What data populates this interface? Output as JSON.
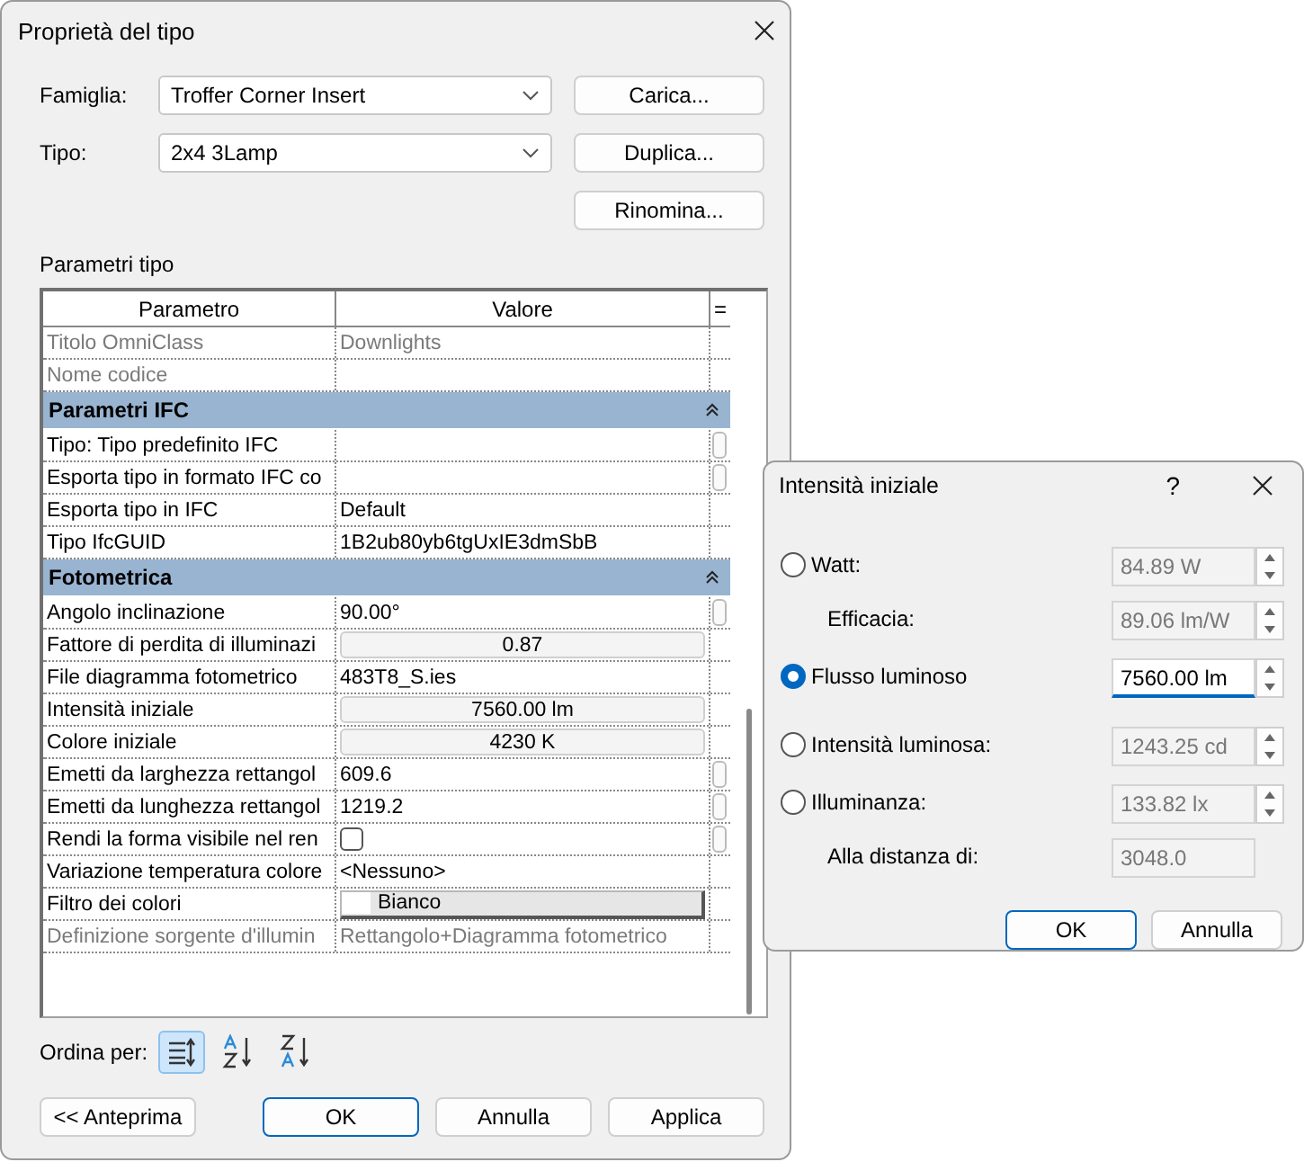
{
  "dialog": {
    "title": "Proprietà del tipo",
    "fields": [
      {
        "label": "Famiglia:",
        "value": "Troffer Corner Insert",
        "button": "Carica..."
      },
      {
        "label": "Tipo:",
        "value": "2x4 3Lamp",
        "button": "Duplica..."
      },
      {
        "button": "Rinomina..."
      }
    ],
    "section_label": "Parametri tipo",
    "table": {
      "columns": [
        "Parametro",
        "Valore",
        "="
      ],
      "rows": [
        {
          "kind": "param",
          "name": "Titolo OmniClass",
          "value": "Downlights",
          "disabled": true,
          "side_button": false
        },
        {
          "kind": "param",
          "name": "Nome codice",
          "value": "",
          "disabled": true,
          "side_button": false
        },
        {
          "kind": "group",
          "name": "Parametri IFC",
          "expanded": true
        },
        {
          "kind": "param",
          "name": "Tipo: Tipo predefinito IFC",
          "value": "",
          "disabled": false,
          "side_button": true
        },
        {
          "kind": "param",
          "name": "Esporta tipo in formato IFC co",
          "value": "",
          "disabled": false,
          "side_button": true
        },
        {
          "kind": "param",
          "name": "Esporta tipo in IFC",
          "value": "Default",
          "disabled": false,
          "side_button": false
        },
        {
          "kind": "param",
          "name": "Tipo IfcGUID",
          "value": "1B2ub80yb6tgUxIE3dmSbB",
          "disabled": false,
          "side_button": false
        },
        {
          "kind": "group",
          "name": "Fotometrica",
          "expanded": true
        },
        {
          "kind": "param",
          "name": "Angolo inclinazione",
          "value": "90.00°",
          "disabled": false,
          "side_button": true
        },
        {
          "kind": "button",
          "name": "Fattore di perdita di illuminazi",
          "value": "0.87",
          "disabled": false,
          "side_button": false
        },
        {
          "kind": "param",
          "name": "File diagramma fotometrico",
          "value": "483T8_S.ies",
          "disabled": false,
          "side_button": false
        },
        {
          "kind": "button",
          "name": "Intensità iniziale",
          "value": "7560.00 lm",
          "disabled": false,
          "side_button": false
        },
        {
          "kind": "button",
          "name": "Colore iniziale",
          "value": "4230 K",
          "disabled": false,
          "side_button": false
        },
        {
          "kind": "param",
          "name": "Emetti da larghezza rettangol",
          "value": "609.6",
          "disabled": false,
          "side_button": true
        },
        {
          "kind": "param",
          "name": "Emetti da lunghezza rettangol",
          "value": "1219.2",
          "disabled": false,
          "side_button": true
        },
        {
          "kind": "checkbox",
          "name": "Rendi la forma visibile nel ren",
          "checked": false,
          "disabled": false,
          "side_button": true
        },
        {
          "kind": "param",
          "name": "Variazione temperatura colore",
          "value": "<Nessuno>",
          "disabled": false,
          "side_button": false
        },
        {
          "kind": "swatch",
          "name": "Filtro dei colori",
          "value": "Bianco",
          "color": "#ffffff",
          "disabled": false,
          "side_button": false
        },
        {
          "kind": "param",
          "name": "Definizione sorgente d'illumin",
          "value": "Rettangolo+Diagramma fotometrico",
          "disabled": true,
          "side_button": false
        }
      ]
    },
    "sort": {
      "label": "Ordina per:",
      "buttons": [
        {
          "kind": "category",
          "selected": true
        },
        {
          "kind": "ascending",
          "selected": false
        },
        {
          "kind": "descending",
          "selected": false
        }
      ]
    },
    "buttons": [
      {
        "label": "<< Anteprima",
        "default": false
      },
      {
        "label": "OK",
        "default": true
      },
      {
        "label": "Annulla",
        "default": false
      },
      {
        "label": "Applica",
        "default": false
      }
    ]
  },
  "popup": {
    "title": "Intensità iniziale",
    "help": "?",
    "rows": [
      {
        "kind": "radio",
        "label": "Watt:",
        "selected": false,
        "value": "84.89 W",
        "spinner": true
      },
      {
        "kind": "sub",
        "label": "Efficacia:",
        "value": "89.06 lm/W",
        "spinner": true
      },
      {
        "kind": "radio",
        "label": "Flusso luminoso",
        "selected": true,
        "value": "7560.00 lm",
        "spinner": true
      },
      {
        "kind": "radio",
        "label": "Intensità luminosa:",
        "selected": false,
        "value": "1243.25 cd",
        "spinner": true
      },
      {
        "kind": "radio",
        "label": "Illuminanza:",
        "selected": false,
        "value": "133.82 lx",
        "spinner": true
      },
      {
        "kind": "sub",
        "label": "Alla distanza di:",
        "value": "3048.0",
        "spinner": false
      }
    ],
    "buttons": [
      {
        "label": "OK",
        "default": true
      },
      {
        "label": "Annulla",
        "default": false
      }
    ]
  }
}
